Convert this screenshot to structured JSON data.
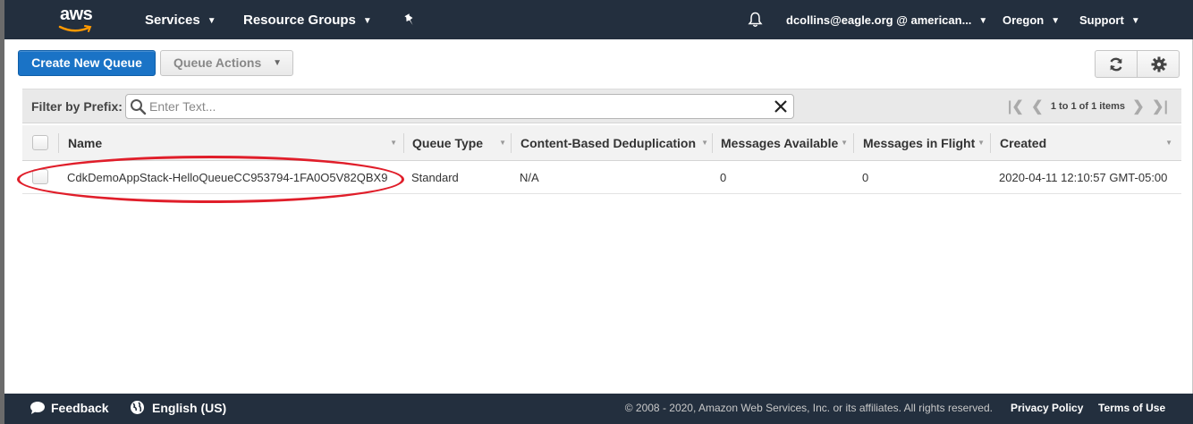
{
  "nav": {
    "logo_text": "aws",
    "services": "Services",
    "resource_groups": "Resource Groups",
    "account": "dcollins@eagle.org @ american...",
    "region": "Oregon",
    "support": "Support"
  },
  "toolbar": {
    "create_label": "Create New Queue",
    "actions_label": "Queue Actions"
  },
  "filter": {
    "label": "Filter by Prefix:",
    "placeholder": "Enter Text...",
    "pagination": "1 to 1 of 1 items"
  },
  "table": {
    "columns": [
      "Name",
      "Queue Type",
      "Content-Based Deduplication",
      "Messages Available",
      "Messages in Flight",
      "Created"
    ],
    "rows": [
      {
        "name": "CdkDemoAppStack-HelloQueueCC953794-1FA0O5V82QBX9",
        "queue_type": "Standard",
        "dedup": "N/A",
        "available": "0",
        "in_flight": "0",
        "created": "2020-04-11 12:10:57 GMT-05:00"
      }
    ]
  },
  "footer": {
    "feedback": "Feedback",
    "language": "English (US)",
    "copyright": "© 2008 - 2020, Amazon Web Services, Inc. or its affiliates. All rights reserved.",
    "privacy": "Privacy Policy",
    "terms": "Terms of Use"
  },
  "colors": {
    "nav_bg": "#232f3e",
    "primary_button": "#1a73c6",
    "aws_orange": "#ff9900",
    "highlight_annotation": "#e01e2a"
  }
}
